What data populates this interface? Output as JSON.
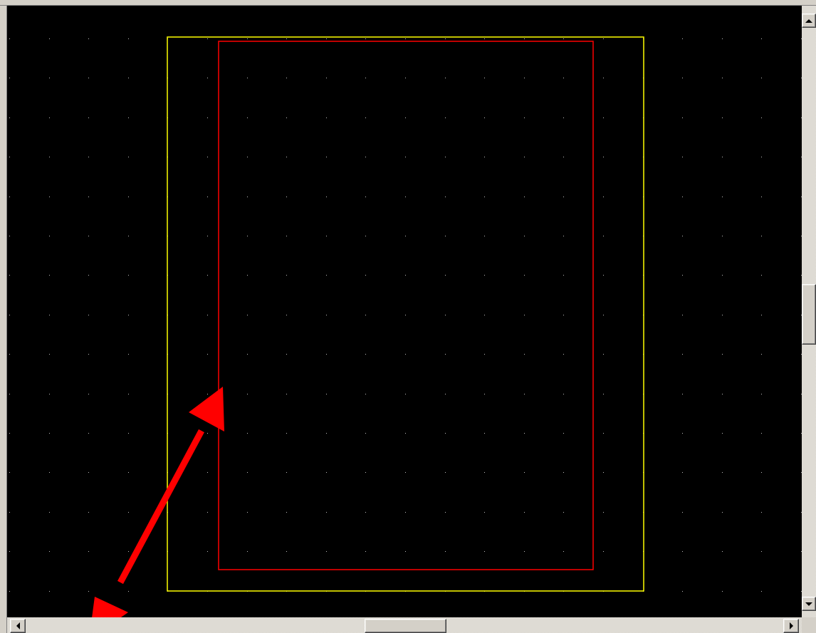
{
  "app": {
    "description_visible_text": ""
  },
  "canvas": {
    "background_color": "#000000",
    "grid_dot_color": "#c0c0c0",
    "outer_boundary_color": "#ffff00",
    "inner_boundary_color": "#ff0000",
    "annotation_arrow_color": "#ff0000"
  },
  "icons": {
    "scroll_up": "arrow-up-icon",
    "scroll_down": "arrow-down-icon",
    "scroll_left": "arrow-left-icon",
    "scroll_right": "arrow-right-icon"
  },
  "scrollbars": {
    "vertical_thumb_fraction": 0.45,
    "horizontal_thumb_fraction": 0.5
  }
}
